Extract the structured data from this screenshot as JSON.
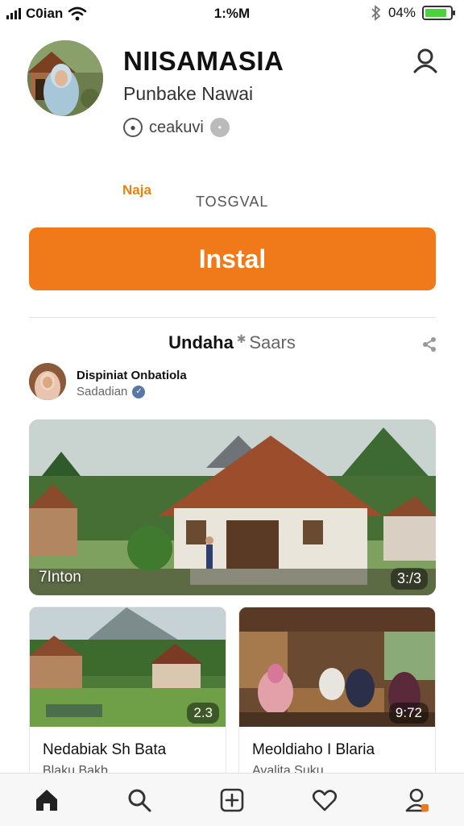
{
  "status_bar": {
    "carrier": "C0ian",
    "time": "1:%M",
    "battery_percent": "04%",
    "battery_level": 0.85,
    "battery_color": "#4cd23c"
  },
  "profile": {
    "title": "NIISAMASIA",
    "subtitle": "Punbake Nawai",
    "meta_label": "ceakuvi",
    "profile_icon": "person-icon"
  },
  "info": {
    "orange_label": "Naja",
    "grey_label": "TOSGVAL"
  },
  "install_button": {
    "label": "Instal",
    "color": "#f07a1a"
  },
  "section": {
    "title_bold": "Undaha",
    "title_rest": "Saars"
  },
  "poster": {
    "name": "Dispiniat Onbatiola",
    "status": "Sadadian"
  },
  "hero": {
    "caption": "7Inton",
    "count": "3:/3"
  },
  "cards": [
    {
      "title": "Nedabiak Sh Bata",
      "subtitle": "Blaku Bakb",
      "count": "2.3"
    },
    {
      "title": "Meoldiaho I Blaria",
      "subtitle": "Avalita Suku",
      "count": "9:72"
    }
  ],
  "bottom_nav": [
    {
      "name": "home-icon",
      "active": true
    },
    {
      "name": "search-icon",
      "active": false
    },
    {
      "name": "add-icon",
      "active": false
    },
    {
      "name": "heart-icon",
      "active": false
    },
    {
      "name": "profile-icon",
      "active": false
    }
  ],
  "accent_color": "#f07a1a"
}
